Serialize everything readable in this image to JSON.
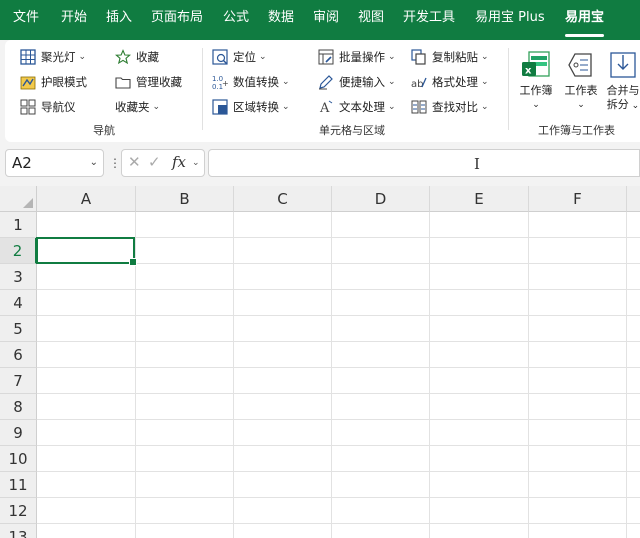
{
  "menubar": {
    "tabs": [
      {
        "label": "文件"
      },
      {
        "label": "开始"
      },
      {
        "label": "插入"
      },
      {
        "label": "页面布局"
      },
      {
        "label": "公式"
      },
      {
        "label": "数据"
      },
      {
        "label": "审阅"
      },
      {
        "label": "视图"
      },
      {
        "label": "开发工具"
      },
      {
        "label": "易用宝 Plus"
      },
      {
        "label": "易用宝",
        "active": true
      }
    ]
  },
  "ribbon": {
    "nav_group": {
      "label": "导航",
      "buttons": {
        "spotlight": "聚光灯",
        "eye_mode": "护眼模式",
        "navigator": "导航仪",
        "favorite": "收藏",
        "manage_favorites": "管理收藏",
        "favorites_folder": "收藏夹"
      }
    },
    "cells_group": {
      "label": "单元格与区域",
      "buttons": {
        "locate": "定位",
        "number_convert": "数值转换",
        "range_convert": "区域转换",
        "batch_ops": "批量操作",
        "quick_input": "便捷输入",
        "text_process": "文本处理",
        "copy_paste": "复制粘贴",
        "format_process": "格式处理",
        "find_compare": "查找对比"
      }
    },
    "book_group": {
      "label": "工作簿与工作表",
      "buttons": {
        "workbook": "工作簿",
        "worksheet": "工作表",
        "merge_split_1": "合并与",
        "merge_split_2": "拆分"
      }
    },
    "colors": {
      "accent": "#107c41"
    }
  },
  "formula_bar": {
    "name_box": "A2",
    "formula": ""
  },
  "grid": {
    "columns": [
      "A",
      "B",
      "C",
      "D",
      "E",
      "F"
    ],
    "rows": [
      "1",
      "2",
      "3",
      "4",
      "5",
      "6",
      "7",
      "8",
      "9",
      "10",
      "11",
      "12",
      "13"
    ],
    "selected_cell": "A2"
  }
}
